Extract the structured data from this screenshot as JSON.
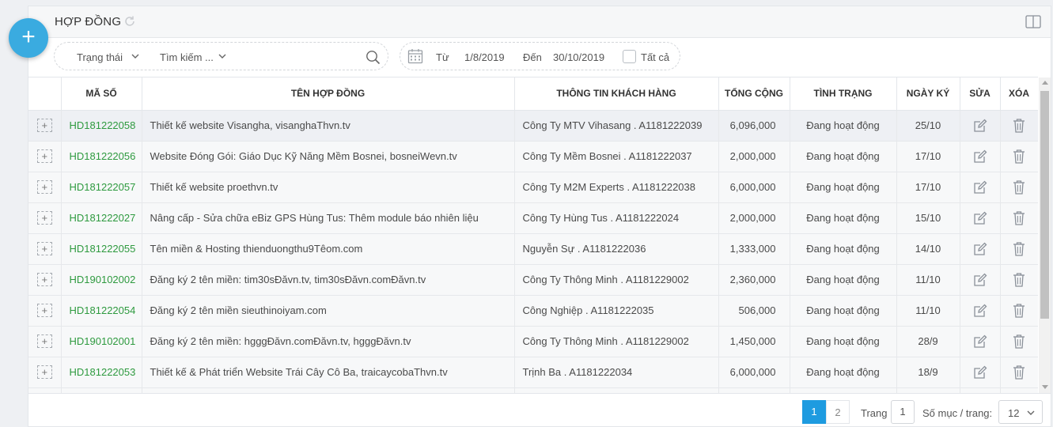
{
  "header": {
    "title": "HỢP ĐỒNG"
  },
  "filters": {
    "status_label": "Trạng thái",
    "search_label": "Tìm kiếm ...",
    "from_label": "Từ",
    "from_date": "1/8/2019",
    "to_label": "Đến",
    "to_date": "30/10/2019",
    "all_label": "Tất cả"
  },
  "table": {
    "headers": [
      "MÃ SỐ",
      "TÊN HỢP ĐỒNG",
      "THÔNG TIN KHÁCH HÀNG",
      "TỔNG CỘNG",
      "TÌNH TRẠNG",
      "NGÀY KÝ",
      "SỬA",
      "XÓA"
    ],
    "rows": [
      {
        "code": "HD181222058",
        "name": "Thiết kế website Visangha, visanghaThvn.tv",
        "customer": "Công Ty MTV Vihasang . A1181222039",
        "total": "6,096,000",
        "status": "Đang hoạt động",
        "date": "25/10"
      },
      {
        "code": "HD181222056",
        "name": "Website Đóng Gói: Giáo Dục Kỹ Năng Mềm Bosnei, bosneiWevn.tv",
        "customer": "Công Ty Mềm Bosnei . A1181222037",
        "total": "2,000,000",
        "status": "Đang hoạt động",
        "date": "17/10"
      },
      {
        "code": "HD181222057",
        "name": "Thiết kế website proethvn.tv",
        "customer": "Công Ty M2M Experts . A1181222038",
        "total": "6,000,000",
        "status": "Đang hoạt động",
        "date": "17/10"
      },
      {
        "code": "HD181222027",
        "name": "Nâng cấp - Sửa chữa eBiz GPS Hùng Tus: Thêm module báo nhiên liệu",
        "customer": "Công Ty Hùng Tus . A1181222024",
        "total": "2,000,000",
        "status": "Đang hoạt động",
        "date": "15/10"
      },
      {
        "code": "HD181222055",
        "name": "Tên miền & Hosting thienduongthu9Têom.com",
        "customer": "Nguyễn Sự . A1181222036",
        "total": "1,333,000",
        "status": "Đang hoạt động",
        "date": "14/10"
      },
      {
        "code": "HD190102002",
        "name": "Đăng ký 2 tên miền: tim30sĐăvn.tv, tim30sĐăvn.comĐăvn.tv",
        "customer": "Công Ty Thông Minh . A1181229002",
        "total": "2,360,000",
        "status": "Đang hoạt động",
        "date": "11/10"
      },
      {
        "code": "HD181222054",
        "name": "Đăng ký 2 tên miền sieuthinoiyam.com",
        "customer": "Công Nghiệp . A1181222035",
        "total": "506,000",
        "status": "Đang hoạt động",
        "date": "11/10"
      },
      {
        "code": "HD190102001",
        "name": "Đăng ký 2 tên miền: hgggĐăvn.comĐăvn.tv, hgggĐăvn.tv",
        "customer": "Công Ty Thông Minh . A1181229002",
        "total": "1,450,000",
        "status": "Đang hoạt động",
        "date": "28/9"
      },
      {
        "code": "HD181222053",
        "name": "Thiết kế & Phát triển Website Trái Cây Cô Ba, traicaycobaThvn.tv",
        "customer": "Trịnh Ba . A1181222034",
        "total": "6,000,000",
        "status": "Đang hoạt động",
        "date": "18/9"
      }
    ]
  },
  "pagination": {
    "pages": [
      "1",
      "2"
    ],
    "page_label": "Trang",
    "page_value": "1",
    "per_page_label": "Số mục / trang:",
    "per_page_value": "12"
  },
  "colors": {
    "accent": "#1e9be0",
    "fab": "#3aabe0",
    "code_green": "#2e9a3f"
  }
}
